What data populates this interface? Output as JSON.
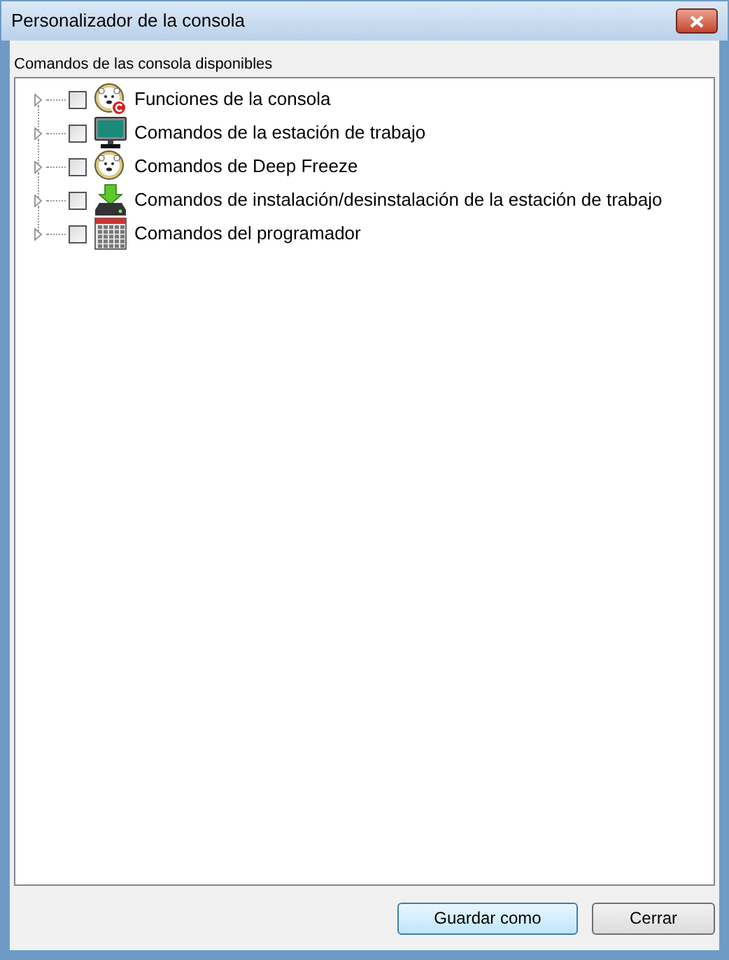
{
  "window": {
    "title": "Personalizador de la consola"
  },
  "tree": {
    "label": "Comandos de las consola disponibles",
    "items": [
      {
        "label": "Funciones de la consola",
        "checked": false,
        "expanded": false
      },
      {
        "label": "Comandos de la estación de trabajo",
        "checked": false,
        "expanded": false
      },
      {
        "label": "Comandos de Deep Freeze",
        "checked": false,
        "expanded": false
      },
      {
        "label": "Comandos de instalación/desinstalación de la estación de trabajo",
        "checked": false,
        "expanded": false
      },
      {
        "label": "Comandos del programador",
        "checked": false,
        "expanded": false
      }
    ]
  },
  "buttons": [
    {
      "label": "Guardar como",
      "default": true
    },
    {
      "label": "Cerrar",
      "default": false
    }
  ]
}
